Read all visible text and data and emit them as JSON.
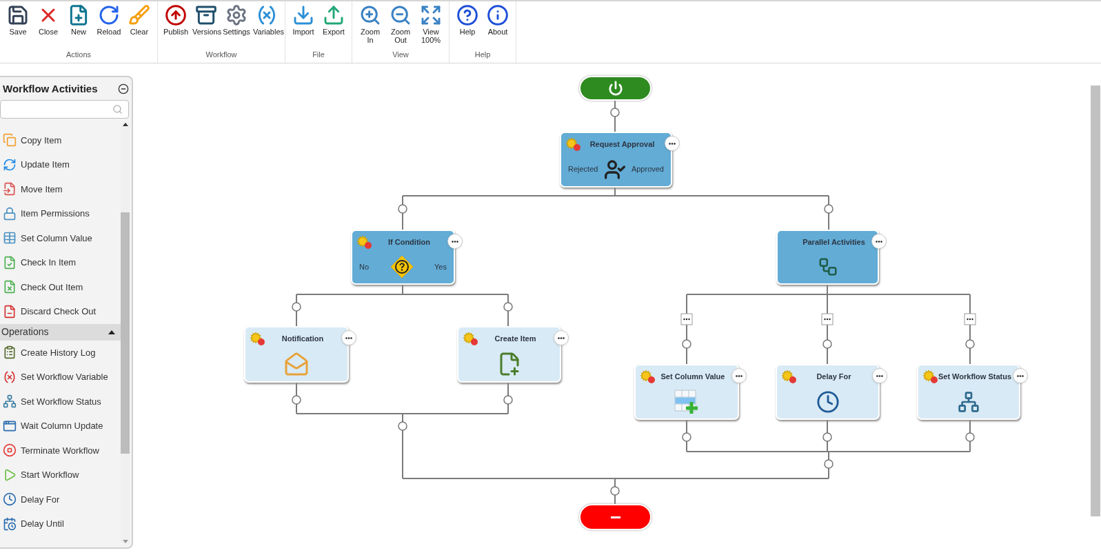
{
  "toolbar": {
    "groups": [
      {
        "label": "Actions",
        "buttons": [
          {
            "label": "Save"
          },
          {
            "label": "Close"
          },
          {
            "label": "New"
          },
          {
            "label": "Reload"
          },
          {
            "label": "Clear"
          }
        ]
      },
      {
        "label": "Workflow",
        "buttons": [
          {
            "label": "Publish"
          },
          {
            "label": "Versions"
          },
          {
            "label": "Settings"
          },
          {
            "label": "Variables"
          }
        ]
      },
      {
        "label": "File",
        "buttons": [
          {
            "label": "Import"
          },
          {
            "label": "Export"
          }
        ]
      },
      {
        "label": "View",
        "buttons": [
          {
            "label": "Zoom In"
          },
          {
            "label": "Zoom Out"
          },
          {
            "label": "View 100%"
          }
        ]
      },
      {
        "label": "Help",
        "buttons": [
          {
            "label": "Help"
          },
          {
            "label": "About"
          }
        ]
      }
    ]
  },
  "sidebar": {
    "title": "Workflow Activities",
    "items": [
      {
        "label": "Copy Item"
      },
      {
        "label": "Update Item"
      },
      {
        "label": "Move Item"
      },
      {
        "label": "Item Permissions"
      },
      {
        "label": "Set Column Value"
      },
      {
        "label": "Check In Item"
      },
      {
        "label": "Check Out Item"
      },
      {
        "label": "Discard Check Out"
      }
    ],
    "sections": [
      {
        "title": "Operations",
        "expanded": true,
        "items": [
          {
            "label": "Create History Log"
          },
          {
            "label": "Set Workflow Variable"
          },
          {
            "label": "Set Workflow Status"
          },
          {
            "label": "Wait Column Update"
          },
          {
            "label": "Terminate Workflow"
          },
          {
            "label": "Start Workflow"
          },
          {
            "label": "Delay For"
          },
          {
            "label": "Delay Until"
          }
        ]
      }
    ]
  },
  "diagram": {
    "nodes": [
      {
        "kind": "start"
      },
      {
        "kind": "branch",
        "title": "Request Approval",
        "warning": true,
        "left_label": "Rejected",
        "right_label": "Approved"
      },
      {
        "kind": "branch",
        "title": "If Condition",
        "warning": true,
        "left_label": "No",
        "right_label": "Yes"
      },
      {
        "kind": "branch",
        "title": "Parallel Activities",
        "warning": false
      },
      {
        "kind": "action",
        "title": "Notification",
        "warning": true
      },
      {
        "kind": "action",
        "title": "Create Item",
        "warning": true
      },
      {
        "kind": "action",
        "title": "Set Column Value",
        "warning": true
      },
      {
        "kind": "action",
        "title": "Delay For",
        "warning": true
      },
      {
        "kind": "action",
        "title": "Set Workflow Status",
        "warning": true
      },
      {
        "kind": "end"
      }
    ]
  }
}
